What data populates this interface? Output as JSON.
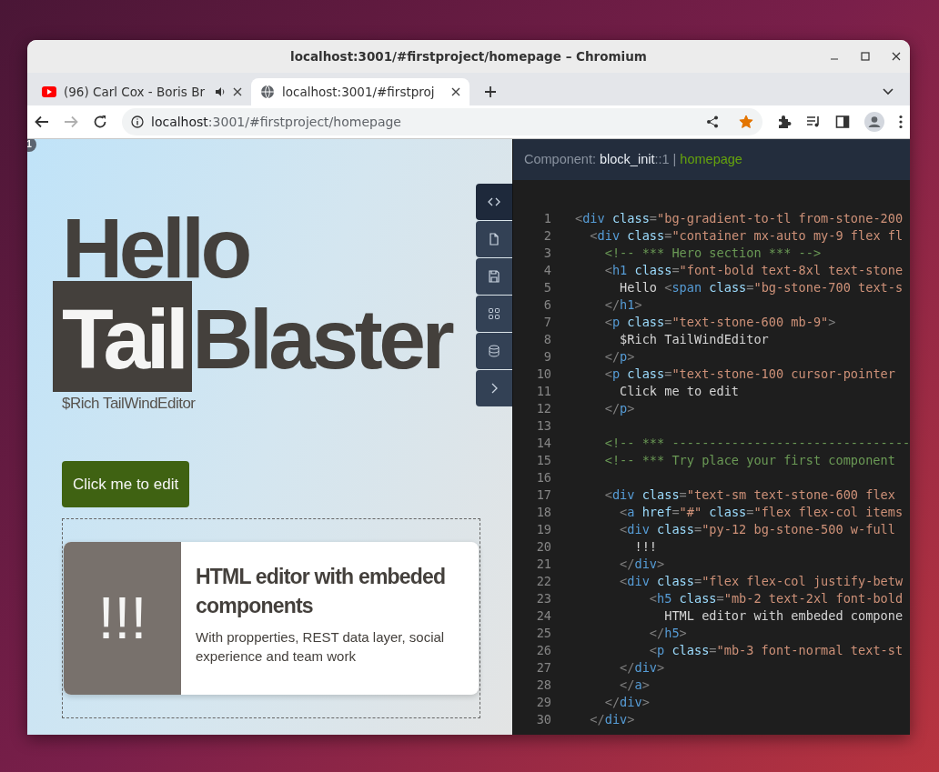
{
  "window": {
    "title": "localhost:3001/#firstproject/homepage – Chromium"
  },
  "tabs": [
    {
      "title": "(96) Carl Cox - Boris Br",
      "kind": "video",
      "audio": true,
      "selected": false
    },
    {
      "title": "localhost:3001/#firstproj",
      "kind": "page",
      "audio": false,
      "selected": true
    }
  ],
  "toolbar": {
    "forward_disabled": true,
    "address": {
      "host": "localhost",
      "path": ":3001/#firstproject/homepage"
    },
    "bookmarked": true
  },
  "preview": {
    "badge": "1",
    "hero": {
      "first": "Hello",
      "highlight": "Tail",
      "rest": "Blaster"
    },
    "subtitle": "$Rich TailWindEditor",
    "button": "Click me to edit",
    "card": {
      "image_text": "!!!",
      "title": "HTML editor with embeded components",
      "text": "With propperties, REST data layer, social experience and team work"
    }
  },
  "side_tools": [
    {
      "kind": "code",
      "selected": true
    },
    {
      "kind": "file",
      "selected": false
    },
    {
      "kind": "save",
      "selected": false
    },
    {
      "kind": "grid",
      "selected": false
    },
    {
      "kind": "database",
      "selected": false
    },
    {
      "kind": "expand",
      "selected": false
    }
  ],
  "editor": {
    "header": {
      "label": "Component:",
      "component": "block_init",
      "index": "::1",
      "separator": "|",
      "page": "homepage"
    },
    "lines": [
      {
        "number": "1",
        "tokens": [
          {
            "kind": "punct",
            "text": "<"
          },
          {
            "kind": "tag",
            "text": "div"
          },
          {
            "kind": "attr",
            "text": " class"
          },
          {
            "kind": "punct",
            "text": "="
          },
          {
            "kind": "string",
            "text": "\"bg-gradient-to-tl from-stone-200"
          }
        ]
      },
      {
        "number": "2",
        "tokens": [
          {
            "kind": "punct",
            "text": "  <"
          },
          {
            "kind": "tag",
            "text": "div"
          },
          {
            "kind": "attr",
            "text": " class"
          },
          {
            "kind": "punct",
            "text": "="
          },
          {
            "kind": "string",
            "text": "\"container mx-auto my-9 flex fl"
          }
        ]
      },
      {
        "number": "3",
        "tokens": [
          {
            "kind": "comment",
            "text": "    <!-- *** Hero section *** -->"
          }
        ]
      },
      {
        "number": "4",
        "tokens": [
          {
            "kind": "punct",
            "text": "    <"
          },
          {
            "kind": "tag",
            "text": "h1"
          },
          {
            "kind": "attr",
            "text": " class"
          },
          {
            "kind": "punct",
            "text": "="
          },
          {
            "kind": "string",
            "text": "\"font-bold text-8xl text-stone"
          }
        ]
      },
      {
        "number": "5",
        "tokens": [
          {
            "kind": "text",
            "text": "      Hello "
          },
          {
            "kind": "punct",
            "text": "<"
          },
          {
            "kind": "tag",
            "text": "span"
          },
          {
            "kind": "attr",
            "text": " class"
          },
          {
            "kind": "punct",
            "text": "="
          },
          {
            "kind": "string",
            "text": "\"bg-stone-700 text-s"
          }
        ]
      },
      {
        "number": "6",
        "tokens": [
          {
            "kind": "punct",
            "text": "    </"
          },
          {
            "kind": "tag",
            "text": "h1"
          },
          {
            "kind": "punct",
            "text": ">"
          }
        ]
      },
      {
        "number": "7",
        "tokens": [
          {
            "kind": "punct",
            "text": "    <"
          },
          {
            "kind": "tag",
            "text": "p"
          },
          {
            "kind": "attr",
            "text": " class"
          },
          {
            "kind": "punct",
            "text": "="
          },
          {
            "kind": "string",
            "text": "\"text-stone-600 mb-9\""
          },
          {
            "kind": "punct",
            "text": ">"
          }
        ]
      },
      {
        "number": "8",
        "tokens": [
          {
            "kind": "text",
            "text": "      $Rich TailWindEditor"
          }
        ]
      },
      {
        "number": "9",
        "tokens": [
          {
            "kind": "punct",
            "text": "    </"
          },
          {
            "kind": "tag",
            "text": "p"
          },
          {
            "kind": "punct",
            "text": ">"
          }
        ]
      },
      {
        "number": "10",
        "tokens": [
          {
            "kind": "punct",
            "text": "    <"
          },
          {
            "kind": "tag",
            "text": "p"
          },
          {
            "kind": "attr",
            "text": " class"
          },
          {
            "kind": "punct",
            "text": "="
          },
          {
            "kind": "string",
            "text": "\"text-stone-100 cursor-pointer"
          }
        ]
      },
      {
        "number": "11",
        "tokens": [
          {
            "kind": "text",
            "text": "      Click me to edit"
          }
        ]
      },
      {
        "number": "12",
        "tokens": [
          {
            "kind": "punct",
            "text": "    </"
          },
          {
            "kind": "tag",
            "text": "p"
          },
          {
            "kind": "punct",
            "text": ">"
          }
        ]
      },
      {
        "number": "13"
      },
      {
        "number": "14",
        "tokens": [
          {
            "kind": "comment",
            "text": "    <!-- *** --------------------------------"
          }
        ]
      },
      {
        "number": "15",
        "tokens": [
          {
            "kind": "comment",
            "text": "    <!-- *** Try place your first component"
          }
        ]
      },
      {
        "number": "16"
      },
      {
        "number": "17",
        "tokens": [
          {
            "kind": "punct",
            "text": "    <"
          },
          {
            "kind": "tag",
            "text": "div"
          },
          {
            "kind": "attr",
            "text": " class"
          },
          {
            "kind": "punct",
            "text": "="
          },
          {
            "kind": "string",
            "text": "\"text-sm text-stone-600 flex"
          }
        ]
      },
      {
        "number": "18",
        "tokens": [
          {
            "kind": "punct",
            "text": "      <"
          },
          {
            "kind": "tag",
            "text": "a"
          },
          {
            "kind": "attr",
            "text": " href"
          },
          {
            "kind": "punct",
            "text": "="
          },
          {
            "kind": "string",
            "text": "\"#\""
          },
          {
            "kind": "attr",
            "text": " class"
          },
          {
            "kind": "punct",
            "text": "="
          },
          {
            "kind": "string",
            "text": "\"flex flex-col items"
          }
        ]
      },
      {
        "number": "19",
        "tokens": [
          {
            "kind": "punct",
            "text": "      <"
          },
          {
            "kind": "tag",
            "text": "div"
          },
          {
            "kind": "attr",
            "text": " class"
          },
          {
            "kind": "punct",
            "text": "="
          },
          {
            "kind": "string",
            "text": "\"py-12 bg-stone-500 w-full"
          }
        ]
      },
      {
        "number": "20",
        "tokens": [
          {
            "kind": "text",
            "text": "        !!!"
          }
        ]
      },
      {
        "number": "21",
        "tokens": [
          {
            "kind": "punct",
            "text": "      </"
          },
          {
            "kind": "tag",
            "text": "div"
          },
          {
            "kind": "punct",
            "text": ">"
          }
        ]
      },
      {
        "number": "22",
        "tokens": [
          {
            "kind": "punct",
            "text": "      <"
          },
          {
            "kind": "tag",
            "text": "div"
          },
          {
            "kind": "attr",
            "text": " class"
          },
          {
            "kind": "punct",
            "text": "="
          },
          {
            "kind": "string",
            "text": "\"flex flex-col justify-betw"
          }
        ]
      },
      {
        "number": "23",
        "tokens": [
          {
            "kind": "punct",
            "text": "          <"
          },
          {
            "kind": "tag",
            "text": "h5"
          },
          {
            "kind": "attr",
            "text": " class"
          },
          {
            "kind": "punct",
            "text": "="
          },
          {
            "kind": "string",
            "text": "\"mb-2 text-2xl font-bold"
          }
        ]
      },
      {
        "number": "24",
        "tokens": [
          {
            "kind": "text",
            "text": "            HTML editor with embeded compone"
          }
        ]
      },
      {
        "number": "25",
        "tokens": [
          {
            "kind": "punct",
            "text": "          </"
          },
          {
            "kind": "tag",
            "text": "h5"
          },
          {
            "kind": "punct",
            "text": ">"
          }
        ]
      },
      {
        "number": "26",
        "tokens": [
          {
            "kind": "punct",
            "text": "          <"
          },
          {
            "kind": "tag",
            "text": "p"
          },
          {
            "kind": "attr",
            "text": " class"
          },
          {
            "kind": "punct",
            "text": "="
          },
          {
            "kind": "string",
            "text": "\"mb-3 font-normal text-st"
          }
        ]
      },
      {
        "number": "27",
        "tokens": [
          {
            "kind": "punct",
            "text": "      </"
          },
          {
            "kind": "tag",
            "text": "div"
          },
          {
            "kind": "punct",
            "text": ">"
          }
        ]
      },
      {
        "number": "28",
        "tokens": [
          {
            "kind": "punct",
            "text": "      </"
          },
          {
            "kind": "tag",
            "text": "a"
          },
          {
            "kind": "punct",
            "text": ">"
          }
        ]
      },
      {
        "number": "29",
        "tokens": [
          {
            "kind": "punct",
            "text": "    </"
          },
          {
            "kind": "tag",
            "text": "div"
          },
          {
            "kind": "punct",
            "text": ">"
          }
        ]
      },
      {
        "number": "30",
        "tokens": [
          {
            "kind": "punct",
            "text": "  </"
          },
          {
            "kind": "tag",
            "text": "div"
          },
          {
            "kind": "punct",
            "text": ">"
          }
        ]
      }
    ]
  }
}
